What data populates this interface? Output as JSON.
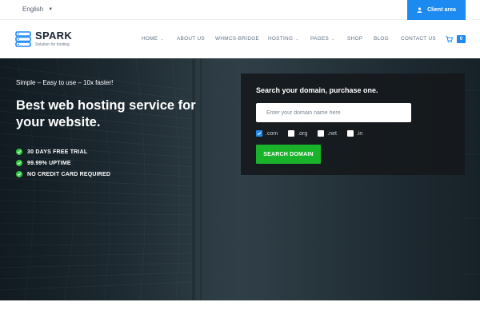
{
  "topbar": {
    "language": "English",
    "client_area_label": "Client area"
  },
  "header": {
    "logo_name": "SPARK",
    "logo_tagline": "Solution for hosting",
    "nav": [
      {
        "label": "HOME",
        "dropdown": true
      },
      {
        "label": "ABOUT US",
        "dropdown": false
      },
      {
        "label": "WHMCS-BRIDGE",
        "dropdown": false
      },
      {
        "label": "HOSTING",
        "dropdown": true
      },
      {
        "label": "PAGES",
        "dropdown": true
      },
      {
        "label": "SHOP",
        "dropdown": false
      },
      {
        "label": "BLOG",
        "dropdown": false
      },
      {
        "label": "CONTACT US",
        "dropdown": false
      }
    ],
    "cart_count": "0"
  },
  "hero": {
    "tagline": "Simple – Easy to use – 10x faster!",
    "headline": "Best web hosting service for your website.",
    "features": [
      "30 DAYS FREE TRIAL",
      "99.99% UPTIME",
      "NO CREDIT CARD REQUIRED"
    ]
  },
  "search": {
    "title": "Search your domain, purchase one.",
    "placeholder": "Enter your domain name here",
    "tlds": [
      {
        "label": ".com",
        "checked": true
      },
      {
        "label": ".org",
        "checked": false
      },
      {
        "label": ".net",
        "checked": false
      },
      {
        "label": ".in",
        "checked": false
      }
    ],
    "button_label": "SEARCH DOMAIN"
  },
  "colors": {
    "accent": "#1d8af2",
    "success": "#19b32b",
    "dark": "#1a2533"
  },
  "icons": {
    "user": "user-icon",
    "cart": "cart-icon",
    "check": "check-circle-icon",
    "logo": "server-stack-icon"
  }
}
